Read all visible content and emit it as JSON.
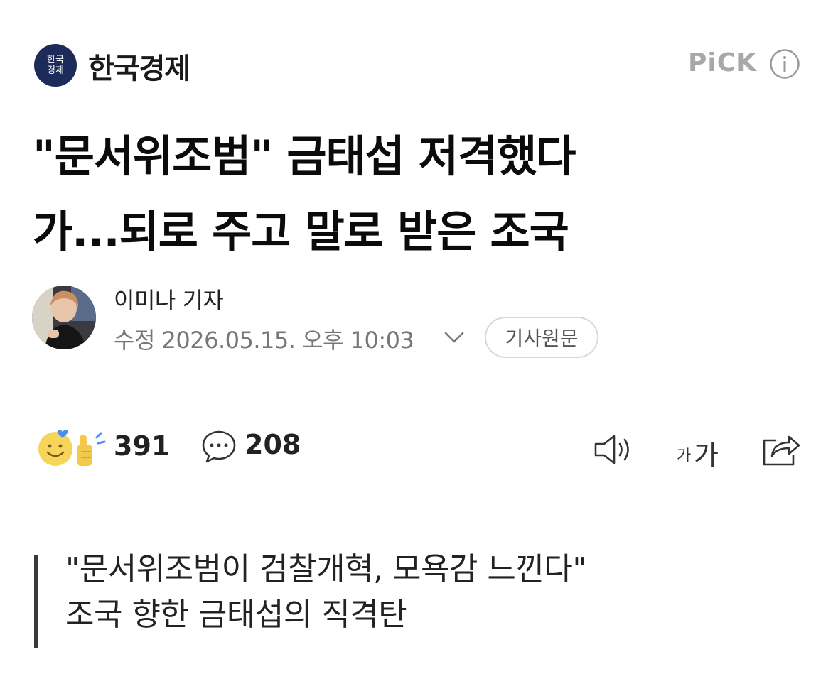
{
  "header": {
    "press_logo_line1": "한국",
    "press_logo_line2": "경제",
    "press_name": "한국경제",
    "pick_label": "PiCK",
    "info_icon": "info-circle-icon"
  },
  "article": {
    "headline_line1": "\"문서위조범\" 금태섭 저격했다",
    "headline_line2": "가...되로 주고 말로 받은 조국",
    "reporter": "이미나 기자",
    "date_line": "수정 2026.05.15. 오후 10:03",
    "original_button": "기사원문"
  },
  "actions": {
    "reaction_icon": "smile-thumbs-up-icon",
    "reaction_count": "391",
    "comment_icon": "speech-bubble-icon",
    "comment_count": "208",
    "speaker_icon": "speaker-icon",
    "font_size_label_small": "가",
    "font_size_label_large": "가",
    "share_icon": "share-icon"
  },
  "subtitle": {
    "line1": "\"문서위조범이 검찰개혁, 모욕감 느낀다\"",
    "line2": "조국 향한 금태섭의 직격탄"
  },
  "colors": {
    "logo_bg": "#1c2b5a",
    "text_primary": "#111111",
    "text_secondary": "#777777",
    "pick": "#a8a8a8",
    "reaction_heart": "#4a8ef0",
    "reaction_face": "#f7d55a"
  }
}
